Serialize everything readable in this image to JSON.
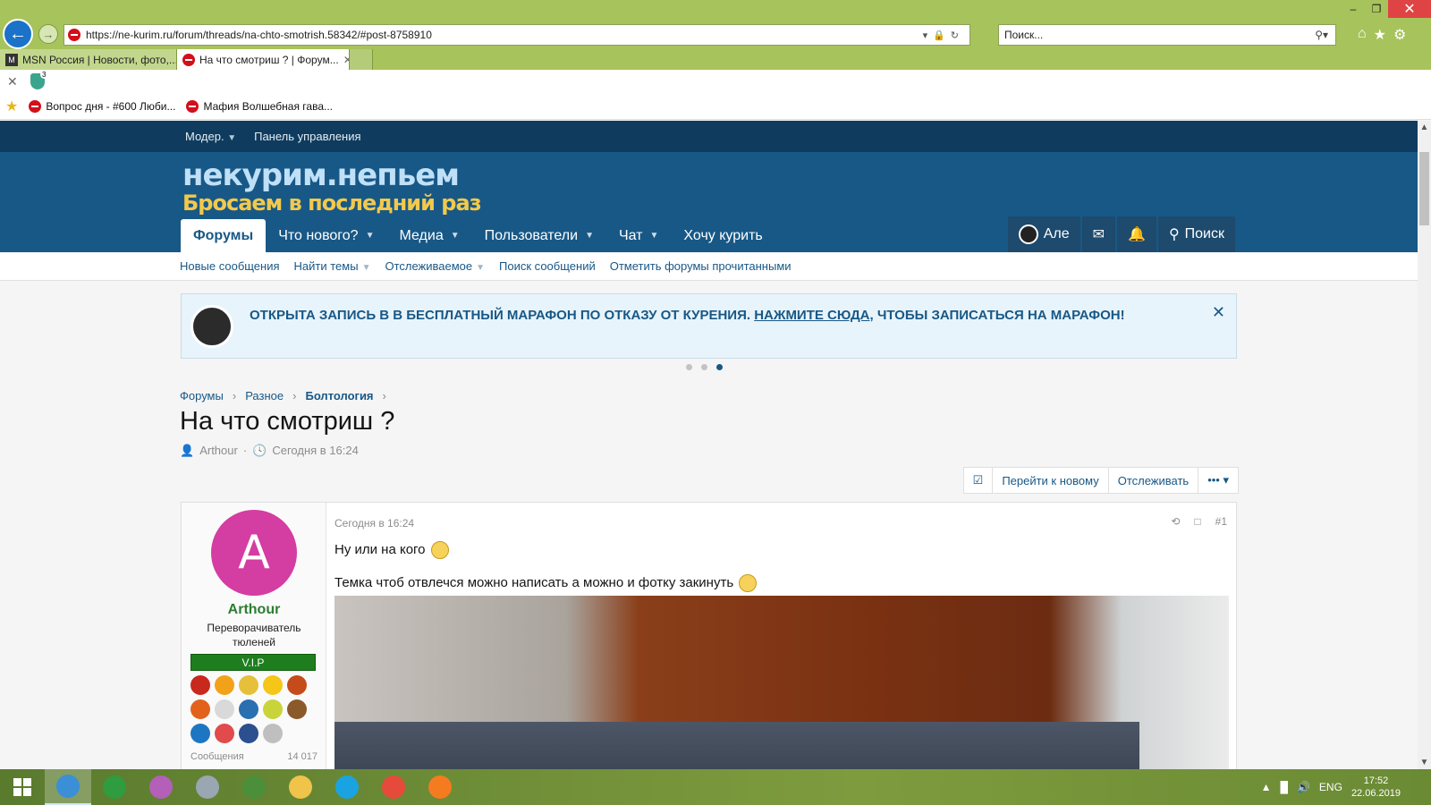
{
  "browser": {
    "url": "https://ne-kurim.ru/forum/threads/na-chto-smotrish.58342/#post-8758910",
    "search_placeholder": "Поиск...",
    "tabs": [
      {
        "label": "MSN Россия | Новости, фото,...",
        "active": false
      },
      {
        "label": "На что смотриш ? | Форум...",
        "active": true
      }
    ],
    "favorites": [
      {
        "label": "Вопрос дня - #600 Люби..."
      },
      {
        "label": "Мафия Волшебная гава..."
      }
    ]
  },
  "site": {
    "mod_links": [
      "Модер.",
      "Панель управления"
    ],
    "logo_line1": "некурим.непьем",
    "logo_line2": "Бросаем в последний раз",
    "nav": [
      {
        "label": "Форумы",
        "active": true,
        "caret": false
      },
      {
        "label": "Что нового?",
        "active": false,
        "caret": true
      },
      {
        "label": "Медиа",
        "active": false,
        "caret": true
      },
      {
        "label": "Пользователи",
        "active": false,
        "caret": true
      },
      {
        "label": "Чат",
        "active": false,
        "caret": true
      },
      {
        "label": "Хочу курить",
        "active": false,
        "caret": false
      }
    ],
    "user_short": "Але",
    "search_label": "Поиск",
    "subnav": [
      {
        "label": "Новые сообщения",
        "caret": false
      },
      {
        "label": "Найти темы",
        "caret": true
      },
      {
        "label": "Отслеживаемое",
        "caret": true
      },
      {
        "label": "Поиск сообщений",
        "caret": false
      },
      {
        "label": "Отметить форумы прочитанными",
        "caret": false
      }
    ],
    "notice": {
      "before": "Открыта запись в в бесплатный марафон по отказу от курения.",
      "link": "Нажмите сюда",
      "after": ", чтобы записаться на марафон!",
      "slide_total": 3,
      "slide_current": 3
    }
  },
  "thread": {
    "breadcrumb": [
      "Форумы",
      "Разное",
      "Болтология"
    ],
    "title": "На что смотриш ?",
    "author": "Arthour",
    "date": "Сегодня в 16:24",
    "actions": [
      "Перейти к новому",
      "Отслеживать"
    ]
  },
  "post": {
    "date": "Сегодня в 16:24",
    "number": "#1",
    "line1": "Ну или на кого",
    "line2": "Темка чтоб отвлечся можно написать а можно и фотку закинуть",
    "user": {
      "avatar_letter": "A",
      "name": "Arthour",
      "title": "Переворачиватель тюленей",
      "badge": "V.I.P",
      "stat_label": "Сообщения",
      "stat_value": "14 017"
    },
    "award_colors": [
      "#c9281d",
      "#f2a219",
      "#e6c03a",
      "#f5c518",
      "#c54b1a",
      "#e2621b",
      "#d9d9d9",
      "#2a6fb0",
      "#c8d43a",
      "#8b5a2b",
      "#1d76c2",
      "#e14b4b",
      "#2b4f8f",
      "#bfbfbf"
    ]
  },
  "taskbar": {
    "lang": "ENG",
    "time": "17:52",
    "date": "22.06.2019",
    "app_colors": [
      "#3a8fd6",
      "#2e9c3f",
      "#b45fb8",
      "#9aa6b2",
      "#4b8f3a",
      "#f0c44a",
      "#1aa3e0",
      "#e64a3b",
      "#f47b20"
    ]
  }
}
